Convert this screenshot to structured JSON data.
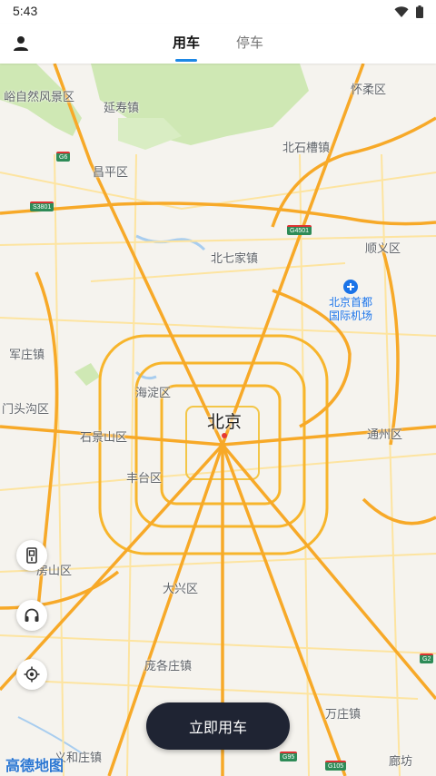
{
  "status_bar": {
    "time": "5:43"
  },
  "header": {
    "tabs": [
      {
        "label": "用车",
        "active": true
      },
      {
        "label": "停车",
        "active": false
      }
    ]
  },
  "map": {
    "city_label": "北京",
    "airport": {
      "line1": "北京首都",
      "line2": "国际机场"
    },
    "places": [
      {
        "id": "shidu",
        "label": "峪自然风景区"
      },
      {
        "id": "yanshou",
        "label": "延寿镇"
      },
      {
        "id": "huairou",
        "label": "怀柔区"
      },
      {
        "id": "beishicao",
        "label": "北石槽镇"
      },
      {
        "id": "changping",
        "label": "昌平区"
      },
      {
        "id": "beiqijia",
        "label": "北七家镇"
      },
      {
        "id": "shunyi",
        "label": "顺义区"
      },
      {
        "id": "junzhuang",
        "label": "军庄镇"
      },
      {
        "id": "haidian",
        "label": "海淀区"
      },
      {
        "id": "mentougou",
        "label": "门头沟区"
      },
      {
        "id": "shijingshan",
        "label": "石景山区"
      },
      {
        "id": "tongzhou",
        "label": "通州区"
      },
      {
        "id": "fengtai",
        "label": "丰台区"
      },
      {
        "id": "fangshan",
        "label": "房山区"
      },
      {
        "id": "daxing",
        "label": "大兴区"
      },
      {
        "id": "pangezhuang",
        "label": "庞各庄镇"
      },
      {
        "id": "wanzhuang",
        "label": "万庄镇"
      },
      {
        "id": "yuhezhuang",
        "label": "义和庄镇"
      },
      {
        "id": "langfang",
        "label": "廊坊"
      }
    ],
    "shields": [
      "G6",
      "S3801",
      "G4501",
      "G95",
      "G105",
      "G2"
    ],
    "logo": "高德地图"
  },
  "action": {
    "start_ride_label": "立即用车"
  },
  "colors": {
    "accent": "#1e88e5",
    "button_dark": "#1f2433",
    "road_major": "#f7b52c",
    "road_minor": "#fde9a8",
    "green_area": "#c8e6a9"
  }
}
